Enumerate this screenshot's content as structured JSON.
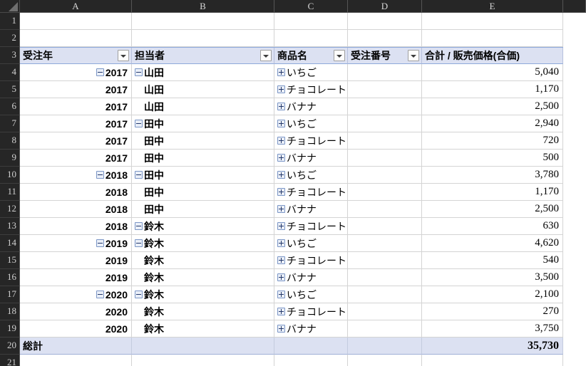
{
  "spreadsheet": {
    "column_headers": [
      "A",
      "B",
      "C",
      "D",
      "E"
    ],
    "row_headers": [
      "1",
      "2",
      "3",
      "4",
      "5",
      "6",
      "7",
      "8",
      "9",
      "10",
      "11",
      "12",
      "13",
      "14",
      "15",
      "16",
      "17",
      "18",
      "19",
      "20",
      "21"
    ],
    "accent_header_bg": "#dce1f2",
    "header_band_bg": "#262626",
    "grid_line_color": "#d4d4d4"
  },
  "pivot": {
    "field_headers": [
      {
        "label": "受注年",
        "has_filter": true
      },
      {
        "label": "担当者",
        "has_filter": true
      },
      {
        "label": "商品名",
        "has_filter": true
      },
      {
        "label": "受注番号",
        "has_filter": true
      },
      {
        "label": "合計 / 販売価格(合価)",
        "has_filter": false
      }
    ],
    "rows": [
      {
        "row": "4",
        "year": "2017",
        "year_btn": "collapse",
        "person": "山田",
        "person_btn": "collapse",
        "product": "いちご",
        "product_btn": "expand",
        "order_no": "",
        "value": "5,040"
      },
      {
        "row": "5",
        "year": "2017",
        "year_btn": "none",
        "person": "山田",
        "person_btn": "none",
        "product": "チョコレート",
        "product_btn": "expand",
        "order_no": "",
        "value": "1,170"
      },
      {
        "row": "6",
        "year": "2017",
        "year_btn": "none",
        "person": "山田",
        "person_btn": "none",
        "product": "バナナ",
        "product_btn": "expand",
        "order_no": "",
        "value": "2,500"
      },
      {
        "row": "7",
        "year": "2017",
        "year_btn": "none",
        "person": "田中",
        "person_btn": "collapse",
        "product": "いちご",
        "product_btn": "expand",
        "order_no": "",
        "value": "2,940"
      },
      {
        "row": "8",
        "year": "2017",
        "year_btn": "none",
        "person": "田中",
        "person_btn": "none",
        "product": "チョコレート",
        "product_btn": "expand",
        "order_no": "",
        "value": "720"
      },
      {
        "row": "9",
        "year": "2017",
        "year_btn": "none",
        "person": "田中",
        "person_btn": "none",
        "product": "バナナ",
        "product_btn": "expand",
        "order_no": "",
        "value": "500"
      },
      {
        "row": "10",
        "year": "2018",
        "year_btn": "collapse",
        "person": "田中",
        "person_btn": "collapse",
        "product": "いちご",
        "product_btn": "expand",
        "order_no": "",
        "value": "3,780"
      },
      {
        "row": "11",
        "year": "2018",
        "year_btn": "none",
        "person": "田中",
        "person_btn": "none",
        "product": "チョコレート",
        "product_btn": "expand",
        "order_no": "",
        "value": "1,170"
      },
      {
        "row": "12",
        "year": "2018",
        "year_btn": "none",
        "person": "田中",
        "person_btn": "none",
        "product": "バナナ",
        "product_btn": "expand",
        "order_no": "",
        "value": "2,500"
      },
      {
        "row": "13",
        "year": "2018",
        "year_btn": "none",
        "person": "鈴木",
        "person_btn": "collapse",
        "product": "チョコレート",
        "product_btn": "expand",
        "order_no": "",
        "value": "630"
      },
      {
        "row": "14",
        "year": "2019",
        "year_btn": "collapse",
        "person": "鈴木",
        "person_btn": "collapse",
        "product": "いちご",
        "product_btn": "expand",
        "order_no": "",
        "value": "4,620"
      },
      {
        "row": "15",
        "year": "2019",
        "year_btn": "none",
        "person": "鈴木",
        "person_btn": "none",
        "product": "チョコレート",
        "product_btn": "expand",
        "order_no": "",
        "value": "540"
      },
      {
        "row": "16",
        "year": "2019",
        "year_btn": "none",
        "person": "鈴木",
        "person_btn": "none",
        "product": "バナナ",
        "product_btn": "expand",
        "order_no": "",
        "value": "3,500"
      },
      {
        "row": "17",
        "year": "2020",
        "year_btn": "collapse",
        "person": "鈴木",
        "person_btn": "collapse",
        "product": "いちご",
        "product_btn": "expand",
        "order_no": "",
        "value": "2,100"
      },
      {
        "row": "18",
        "year": "2020",
        "year_btn": "none",
        "person": "鈴木",
        "person_btn": "none",
        "product": "チョコレート",
        "product_btn": "expand",
        "order_no": "",
        "value": "270"
      },
      {
        "row": "19",
        "year": "2020",
        "year_btn": "none",
        "person": "鈴木",
        "person_btn": "none",
        "product": "バナナ",
        "product_btn": "expand",
        "order_no": "",
        "value": "3,750"
      }
    ],
    "grand_total": {
      "row": "20",
      "label": "総計",
      "value": "35,730"
    }
  }
}
